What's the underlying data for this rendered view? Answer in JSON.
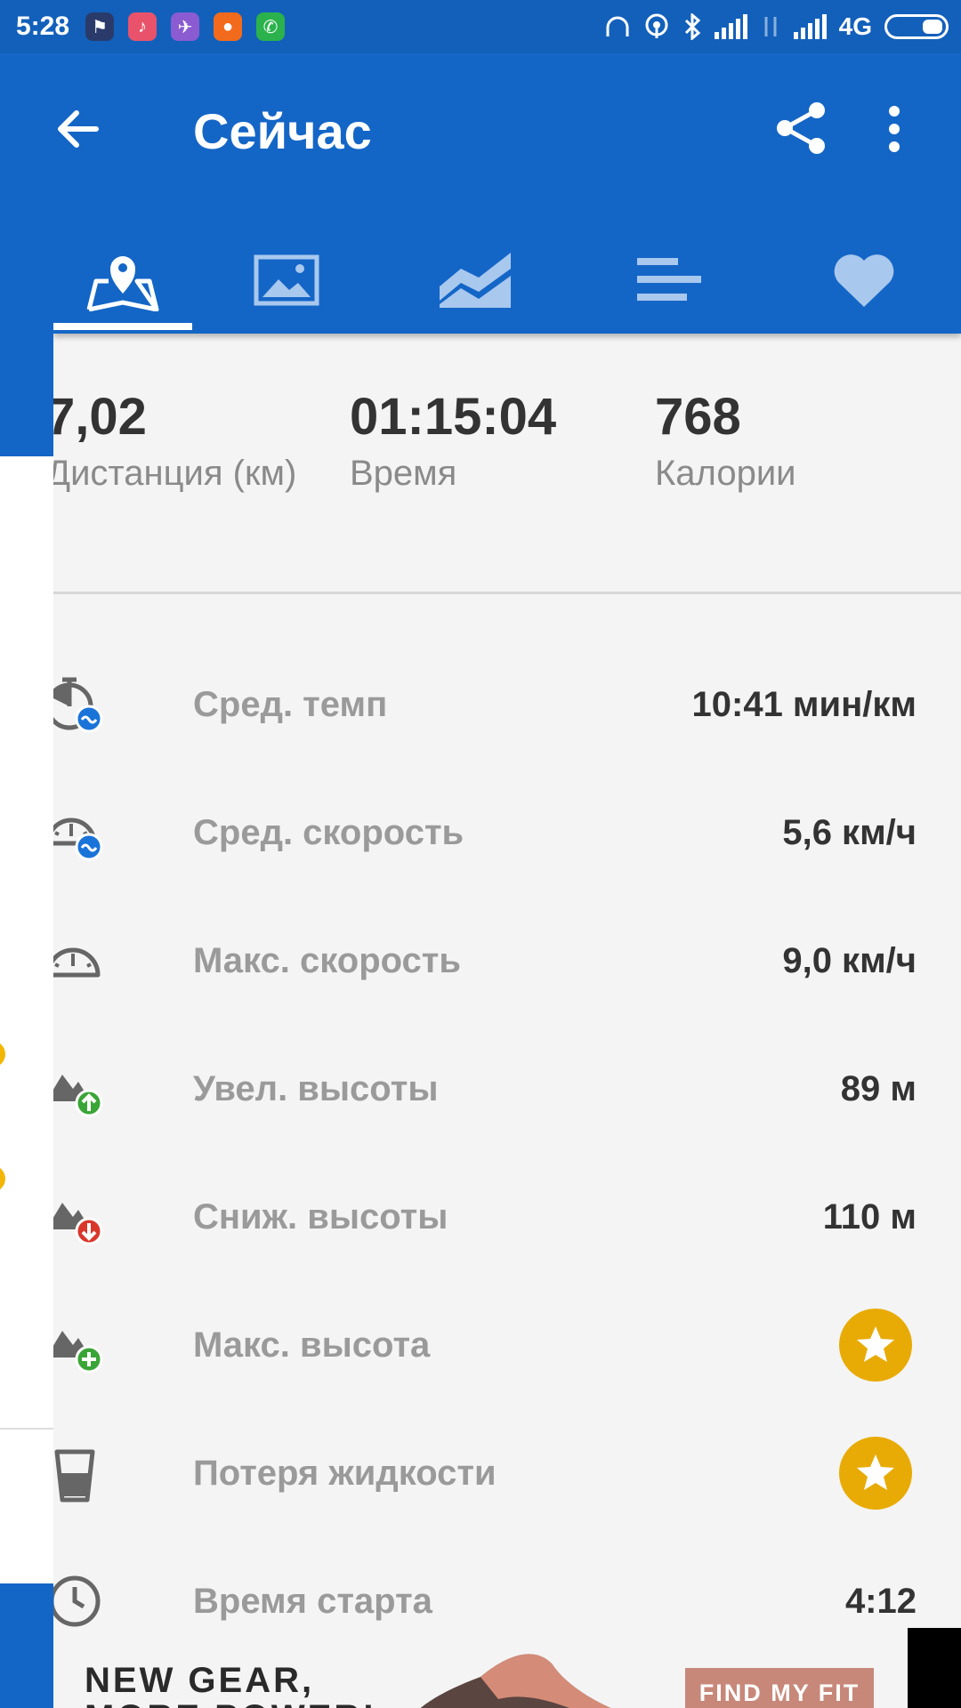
{
  "status_bar": {
    "time": "5:28",
    "network": "4G"
  },
  "header": {
    "title": "Сейчас"
  },
  "tabs": [
    {
      "icon": "map-pin-icon",
      "active": true
    },
    {
      "icon": "image-icon",
      "active": false
    },
    {
      "icon": "area-chart-icon",
      "active": false
    },
    {
      "icon": "bar-list-icon",
      "active": false
    },
    {
      "icon": "heart-icon",
      "active": false
    }
  ],
  "summary": {
    "distance": {
      "value": "7,02",
      "label": "Дистанция (км)"
    },
    "time": {
      "value": "01:15:04",
      "label": "Время"
    },
    "calories": {
      "value": "768",
      "label": "Калории"
    }
  },
  "stats": [
    {
      "label": "Сред. темп",
      "value": "10:41 мин/км",
      "icon": "avg-pace-icon"
    },
    {
      "label": "Сред. скорость",
      "value": "5,6 км/ч",
      "icon": "avg-speed-icon"
    },
    {
      "label": "Макс. скорость",
      "value": "9,0 км/ч",
      "icon": "max-speed-icon"
    },
    {
      "label": "Увел. высоты",
      "value": "89 м",
      "icon": "elevation-gain-icon"
    },
    {
      "label": "Сниж. высоты",
      "value": "110 м",
      "icon": "elevation-loss-icon"
    },
    {
      "label": "Макс. высота",
      "value": null,
      "icon": "max-elevation-icon"
    },
    {
      "label": "Потеря жидкости",
      "value": null,
      "icon": "fluid-loss-icon"
    },
    {
      "label": "Время старта",
      "value": "4:12",
      "icon": "clock-icon"
    }
  ],
  "ad": {
    "line1": "NEW GEAR,",
    "line2": "MORE POWER!",
    "button": "FIND MY FIT"
  },
  "colors": {
    "primary": "#1466c6",
    "status_bar": "#1360bb",
    "premium_star": "#e8ab06",
    "gain_green": "#3aa537",
    "loss_red": "#d9372c",
    "blue_badge": "#1a73d9"
  }
}
